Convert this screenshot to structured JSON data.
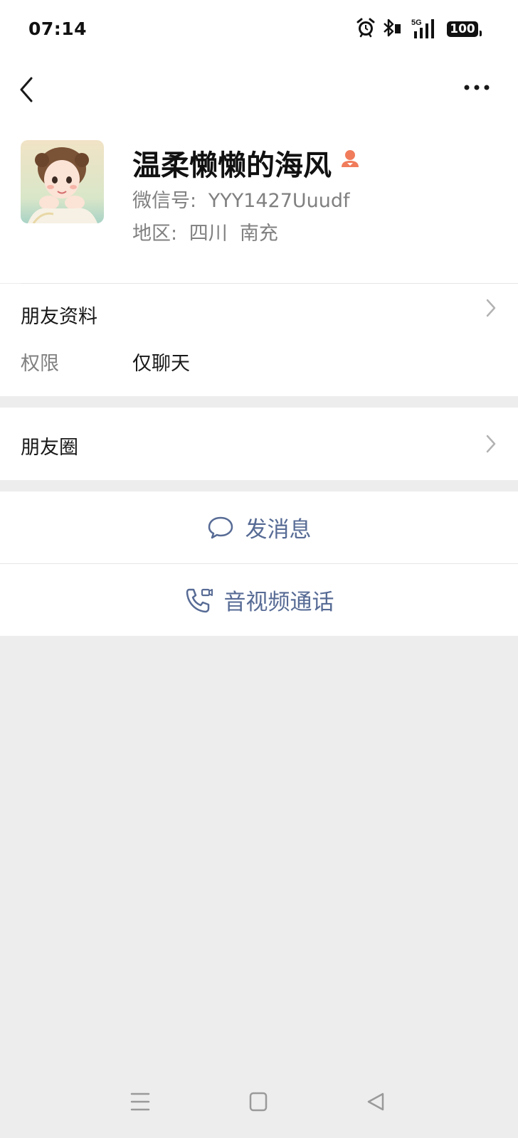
{
  "status_bar": {
    "time": "07:14",
    "network": "5G",
    "battery": "100",
    "icons": [
      "alarm-icon",
      "bluetooth-icon",
      "signal-icon",
      "battery-icon"
    ]
  },
  "nav": {
    "back_icon": "chevron-left-icon",
    "more_icon": "more-dots-icon"
  },
  "profile": {
    "name": "温柔懒懒的海风",
    "gender_icon": "female-icon",
    "wechat_id_label": "微信号:",
    "wechat_id": "YYY1427Uuudf",
    "region_label": "地区:",
    "region": "四川  南充"
  },
  "friend_info": {
    "title": "朋友资料",
    "permission_label": "权限",
    "permission_value": "仅聊天"
  },
  "moments": {
    "title": "朋友圈"
  },
  "actions": {
    "send_message": "发消息",
    "av_call": "音视频通话"
  },
  "colors": {
    "link_blue": "#576b95",
    "gender_orange": "#f07c5c",
    "background": "#ededed"
  }
}
